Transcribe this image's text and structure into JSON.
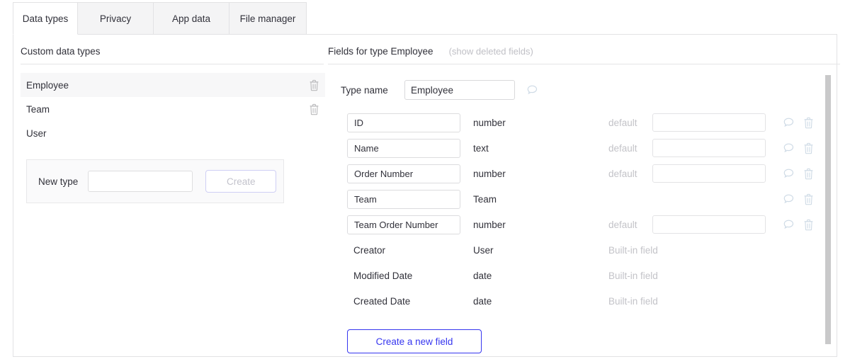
{
  "tabs": [
    {
      "label": "Data types",
      "active": true
    },
    {
      "label": "Privacy",
      "active": false
    },
    {
      "label": "App data",
      "active": false
    },
    {
      "label": "File manager",
      "active": false
    }
  ],
  "left_panel": {
    "title": "Custom data types",
    "types": [
      {
        "name": "Employee",
        "selected": true,
        "deletable": true
      },
      {
        "name": "Team",
        "selected": false,
        "deletable": true
      },
      {
        "name": "User",
        "selected": false,
        "deletable": false
      }
    ],
    "new_type": {
      "label": "New type",
      "value": "",
      "placeholder": "",
      "create_label": "Create",
      "create_disabled": true
    }
  },
  "right_panel": {
    "title": "Fields for type Employee",
    "show_deleted_label": "(show deleted fields)",
    "type_name": {
      "label": "Type name",
      "value": "Employee"
    },
    "default_placeholder_label": "default",
    "builtin_label": "Built-in field",
    "fields": [
      {
        "name": "ID",
        "type": "number",
        "editable": true,
        "has_default": true,
        "default_value": ""
      },
      {
        "name": "Name",
        "type": "text",
        "editable": true,
        "has_default": true,
        "default_value": ""
      },
      {
        "name": "Order Number",
        "type": "number",
        "editable": true,
        "has_default": true,
        "default_value": ""
      },
      {
        "name": "Team",
        "type": "Team",
        "editable": true,
        "has_default": false,
        "default_value": ""
      },
      {
        "name": "Team Order Number",
        "type": "number",
        "editable": true,
        "has_default": true,
        "default_value": ""
      },
      {
        "name": "Creator",
        "type": "User",
        "editable": false,
        "has_default": false,
        "default_value": ""
      },
      {
        "name": "Modified Date",
        "type": "date",
        "editable": false,
        "has_default": false,
        "default_value": ""
      },
      {
        "name": "Created Date",
        "type": "date",
        "editable": false,
        "has_default": false,
        "default_value": ""
      }
    ],
    "create_field_label": "Create a new field"
  },
  "icons": {
    "comment": "comment-bubble-icon",
    "trash": "trash-icon"
  },
  "colors": {
    "accent_blue": "#3636ef",
    "muted_text": "#c3c3c8",
    "icon_blue_gray": "#cfdbe6",
    "icon_gray": "#b9b9bb",
    "border": "#e2e2e4",
    "selected_row": "#f7f7f8"
  }
}
